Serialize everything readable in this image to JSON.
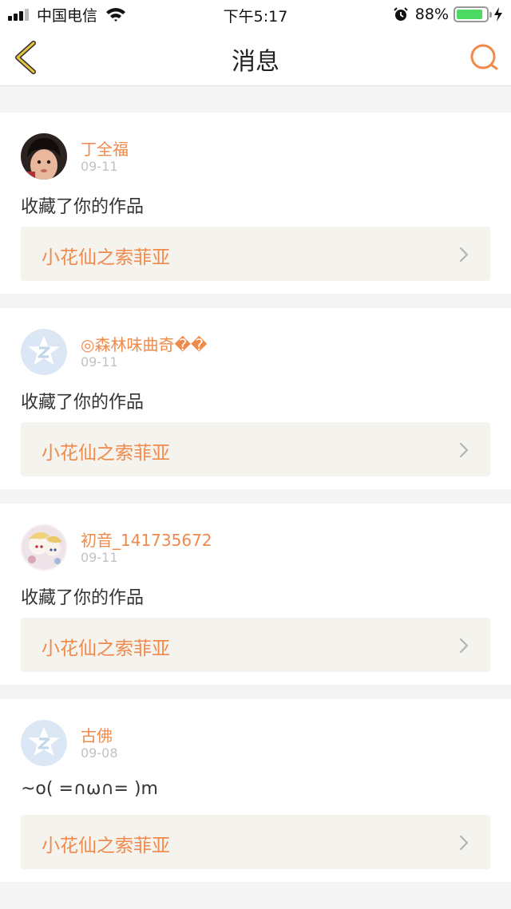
{
  "status_bar": {
    "carrier": "中国电信",
    "time": "下午5:17",
    "battery_pct": "88%",
    "battery_level": 0.88,
    "icons": [
      "signal-icon",
      "wifi-icon",
      "alarm-icon",
      "battery-icon",
      "charging-icon"
    ]
  },
  "nav": {
    "title": "消息",
    "back_icon": "chevron-left-icon",
    "search_icon": "search-icon"
  },
  "colors": {
    "accent": "#f08a4b",
    "back_icon": "#e7c43a",
    "page_bg": "#f4f4f4",
    "link_bg": "#f4f3ee"
  },
  "messages": [
    {
      "user": "丁全福",
      "date": "09-11",
      "text": "收藏了你的作品",
      "work": "小花仙之索菲亚",
      "avatar": "photo-avatar-child"
    },
    {
      "user": "◎森林味曲奇��",
      "date": "09-11",
      "text": "收藏了你的作品",
      "work": "小花仙之索菲亚",
      "avatar": "default-qq-avatar"
    },
    {
      "user": "初音_141735672",
      "date": "09-11",
      "text": "收藏了你的作品",
      "work": "小花仙之索菲亚",
      "avatar": "photo-avatar-anime"
    },
    {
      "user": "古佛",
      "date": "09-08",
      "text": "~o( =∩ω∩= )m",
      "work": "小花仙之索菲亚",
      "avatar": "default-qq-avatar"
    }
  ]
}
